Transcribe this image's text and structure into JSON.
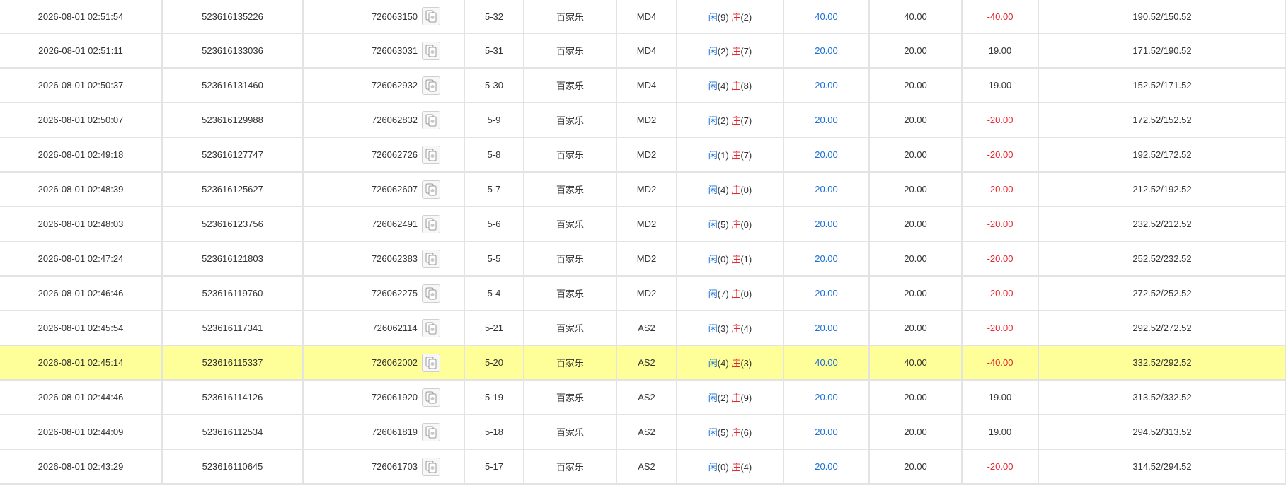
{
  "colors": {
    "player": "#1a6fd6",
    "banker": "#e8212b",
    "highlight": "#ffff99",
    "grid": "#e3e3e3"
  },
  "icon": "cards-icon",
  "rows": [
    {
      "time": "2026-08-01 02:51:54",
      "order_id": "523616135226",
      "round_id": "726063150",
      "shoe": "5-32",
      "game": "百家乐",
      "table": "MD4",
      "player_label": "闲",
      "player_score": "(9)",
      "banker_label": "庄",
      "banker_score": "(2)",
      "bet": "40.00",
      "valid_bet": "40.00",
      "win_loss": "-40.00",
      "win_loss_color": "red",
      "balance": "190.52/150.52",
      "highlight": false
    },
    {
      "time": "2026-08-01 02:51:11",
      "order_id": "523616133036",
      "round_id": "726063031",
      "shoe": "5-31",
      "game": "百家乐",
      "table": "MD4",
      "player_label": "闲",
      "player_score": "(2)",
      "banker_label": "庄",
      "banker_score": "(7)",
      "bet": "20.00",
      "valid_bet": "20.00",
      "win_loss": "19.00",
      "win_loss_color": "dark",
      "balance": "171.52/190.52",
      "highlight": false
    },
    {
      "time": "2026-08-01 02:50:37",
      "order_id": "523616131460",
      "round_id": "726062932",
      "shoe": "5-30",
      "game": "百家乐",
      "table": "MD4",
      "player_label": "闲",
      "player_score": "(4)",
      "banker_label": "庄",
      "banker_score": "(8)",
      "bet": "20.00",
      "valid_bet": "20.00",
      "win_loss": "19.00",
      "win_loss_color": "dark",
      "balance": "152.52/171.52",
      "highlight": false
    },
    {
      "time": "2026-08-01 02:50:07",
      "order_id": "523616129988",
      "round_id": "726062832",
      "shoe": "5-9",
      "game": "百家乐",
      "table": "MD2",
      "player_label": "闲",
      "player_score": "(2)",
      "banker_label": "庄",
      "banker_score": "(7)",
      "bet": "20.00",
      "valid_bet": "20.00",
      "win_loss": "-20.00",
      "win_loss_color": "red",
      "balance": "172.52/152.52",
      "highlight": false
    },
    {
      "time": "2026-08-01 02:49:18",
      "order_id": "523616127747",
      "round_id": "726062726",
      "shoe": "5-8",
      "game": "百家乐",
      "table": "MD2",
      "player_label": "闲",
      "player_score": "(1)",
      "banker_label": "庄",
      "banker_score": "(7)",
      "bet": "20.00",
      "valid_bet": "20.00",
      "win_loss": "-20.00",
      "win_loss_color": "red",
      "balance": "192.52/172.52",
      "highlight": false
    },
    {
      "time": "2026-08-01 02:48:39",
      "order_id": "523616125627",
      "round_id": "726062607",
      "shoe": "5-7",
      "game": "百家乐",
      "table": "MD2",
      "player_label": "闲",
      "player_score": "(4)",
      "banker_label": "庄",
      "banker_score": "(0)",
      "bet": "20.00",
      "valid_bet": "20.00",
      "win_loss": "-20.00",
      "win_loss_color": "red",
      "balance": "212.52/192.52",
      "highlight": false
    },
    {
      "time": "2026-08-01 02:48:03",
      "order_id": "523616123756",
      "round_id": "726062491",
      "shoe": "5-6",
      "game": "百家乐",
      "table": "MD2",
      "player_label": "闲",
      "player_score": "(5)",
      "banker_label": "庄",
      "banker_score": "(0)",
      "bet": "20.00",
      "valid_bet": "20.00",
      "win_loss": "-20.00",
      "win_loss_color": "red",
      "balance": "232.52/212.52",
      "highlight": false
    },
    {
      "time": "2026-08-01 02:47:24",
      "order_id": "523616121803",
      "round_id": "726062383",
      "shoe": "5-5",
      "game": "百家乐",
      "table": "MD2",
      "player_label": "闲",
      "player_score": "(0)",
      "banker_label": "庄",
      "banker_score": "(1)",
      "bet": "20.00",
      "valid_bet": "20.00",
      "win_loss": "-20.00",
      "win_loss_color": "red",
      "balance": "252.52/232.52",
      "highlight": false
    },
    {
      "time": "2026-08-01 02:46:46",
      "order_id": "523616119760",
      "round_id": "726062275",
      "shoe": "5-4",
      "game": "百家乐",
      "table": "MD2",
      "player_label": "闲",
      "player_score": "(7)",
      "banker_label": "庄",
      "banker_score": "(0)",
      "bet": "20.00",
      "valid_bet": "20.00",
      "win_loss": "-20.00",
      "win_loss_color": "red",
      "balance": "272.52/252.52",
      "highlight": false
    },
    {
      "time": "2026-08-01 02:45:54",
      "order_id": "523616117341",
      "round_id": "726062114",
      "shoe": "5-21",
      "game": "百家乐",
      "table": "AS2",
      "player_label": "闲",
      "player_score": "(3)",
      "banker_label": "庄",
      "banker_score": "(4)",
      "bet": "20.00",
      "valid_bet": "20.00",
      "win_loss": "-20.00",
      "win_loss_color": "red",
      "balance": "292.52/272.52",
      "highlight": false
    },
    {
      "time": "2026-08-01 02:45:14",
      "order_id": "523616115337",
      "round_id": "726062002",
      "shoe": "5-20",
      "game": "百家乐",
      "table": "AS2",
      "player_label": "闲",
      "player_score": "(4)",
      "banker_label": "庄",
      "banker_score": "(3)",
      "bet": "40.00",
      "valid_bet": "40.00",
      "win_loss": "-40.00",
      "win_loss_color": "red",
      "balance": "332.52/292.52",
      "highlight": true
    },
    {
      "time": "2026-08-01 02:44:46",
      "order_id": "523616114126",
      "round_id": "726061920",
      "shoe": "5-19",
      "game": "百家乐",
      "table": "AS2",
      "player_label": "闲",
      "player_score": "(2)",
      "banker_label": "庄",
      "banker_score": "(9)",
      "bet": "20.00",
      "valid_bet": "20.00",
      "win_loss": "19.00",
      "win_loss_color": "dark",
      "balance": "313.52/332.52",
      "highlight": false
    },
    {
      "time": "2026-08-01 02:44:09",
      "order_id": "523616112534",
      "round_id": "726061819",
      "shoe": "5-18",
      "game": "百家乐",
      "table": "AS2",
      "player_label": "闲",
      "player_score": "(5)",
      "banker_label": "庄",
      "banker_score": "(6)",
      "bet": "20.00",
      "valid_bet": "20.00",
      "win_loss": "19.00",
      "win_loss_color": "dark",
      "balance": "294.52/313.52",
      "highlight": false
    },
    {
      "time": "2026-08-01 02:43:29",
      "order_id": "523616110645",
      "round_id": "726061703",
      "shoe": "5-17",
      "game": "百家乐",
      "table": "AS2",
      "player_label": "闲",
      "player_score": "(0)",
      "banker_label": "庄",
      "banker_score": "(4)",
      "bet": "20.00",
      "valid_bet": "20.00",
      "win_loss": "-20.00",
      "win_loss_color": "red",
      "balance": "314.52/294.52",
      "highlight": false
    }
  ]
}
